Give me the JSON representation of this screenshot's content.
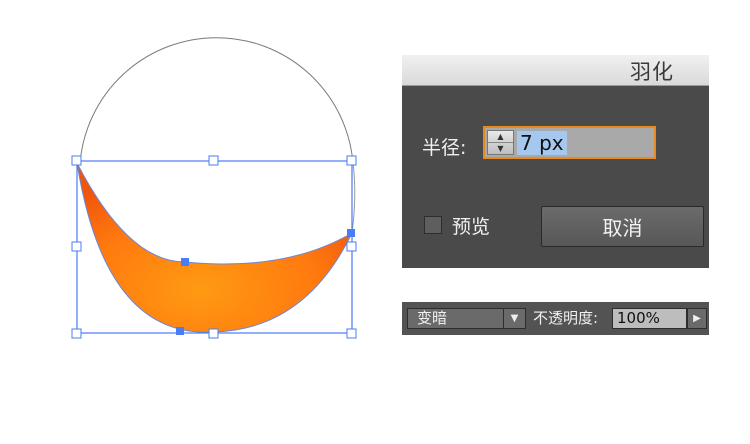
{
  "feather_dialog": {
    "title": "羽化",
    "radius_label": "半径:",
    "radius_value": "7 px",
    "preview_label": "预览",
    "preview_checked": false,
    "cancel_label": "取消"
  },
  "blend_bar": {
    "blend_mode": "变暗",
    "opacity_label": "不透明度:",
    "opacity_value": "100%"
  },
  "icons": {
    "stepper_up": "triangle-up-icon",
    "stepper_down": "triangle-down-icon",
    "dropdown": "chevron-down-icon",
    "flyout": "chevron-right-icon"
  },
  "colors": {
    "selection_blue": "#4a7cf5",
    "fill_orange": "#ff7a0f",
    "field_focus": "#e88a1f",
    "panel_bg": "#4a4a4a"
  }
}
